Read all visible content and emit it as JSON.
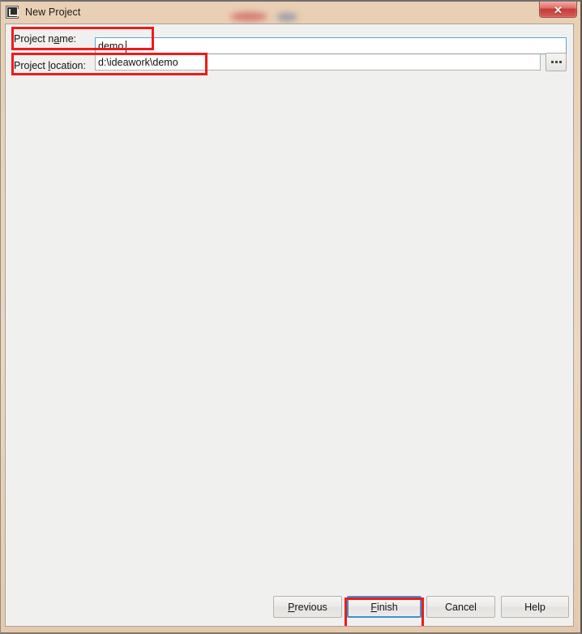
{
  "window": {
    "title": "New Project",
    "app_icon": "intellij-idea-icon",
    "close_label": "✕"
  },
  "form": {
    "name_label_prefix": "Project n",
    "name_label_mnemonic": "a",
    "name_label_suffix": "me:",
    "name_label_full": "Project name:",
    "name_value": "demo",
    "location_label_prefix": "Project ",
    "location_label_mnemonic": "l",
    "location_label_suffix": "ocation:",
    "location_label_full": "Project location:",
    "location_value": "d:\\ideawork\\demo",
    "browse_label": "..."
  },
  "buttons": {
    "previous_mnemonic": "P",
    "previous_rest": "revious",
    "previous_label": "Previous",
    "finish_mnemonic": "F",
    "finish_rest": "inish",
    "finish_label": "Finish",
    "cancel_label": "Cancel",
    "help_label": "Help"
  },
  "annotations": {
    "colors": {
      "highlight": "#ee1b1b",
      "focus": "#3c93d0"
    },
    "items": [
      {
        "target": "project-name-row"
      },
      {
        "target": "project-location-row"
      },
      {
        "target": "finish-button"
      }
    ]
  }
}
